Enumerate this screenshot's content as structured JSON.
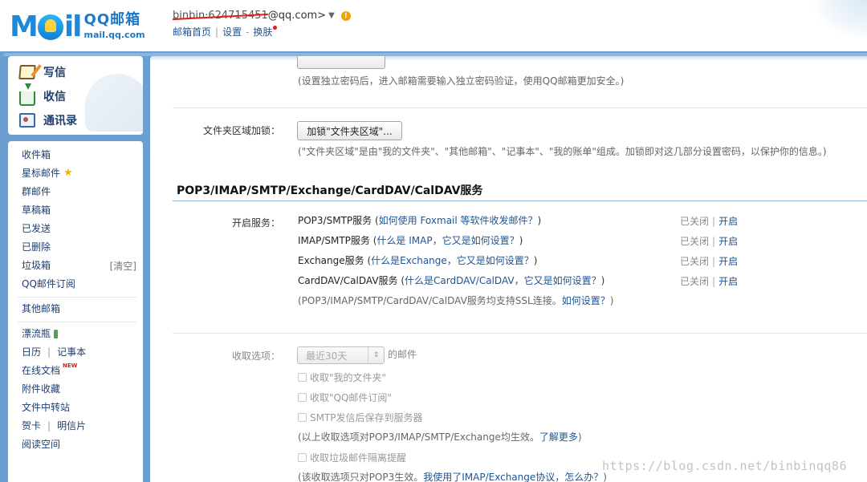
{
  "header": {
    "logo_word": [
      "M",
      "",
      "i",
      "l"
    ],
    "logo_cn": "QQ邮箱",
    "logo_url": "mail.qq.com",
    "account_masked": "binbin·624715451",
    "account_suffix": "@qq.com>",
    "account_arrow": "▼",
    "warn_icon": "!",
    "nav": {
      "home": "邮箱首页",
      "sep1": "|",
      "settings": "设置",
      "sep2": "-",
      "skin": "换肤"
    }
  },
  "sidebar": {
    "quick": [
      {
        "label": "写信",
        "icon": "compose-icon"
      },
      {
        "label": "收信",
        "icon": "receive-icon"
      },
      {
        "label": "通讯录",
        "icon": "contacts-icon"
      }
    ],
    "folders": {
      "inbox": "收件箱",
      "starred": "星标邮件",
      "group": "群邮件",
      "drafts": "草稿箱",
      "sent": "已发送",
      "deleted": "已删除",
      "junk": "垃圾箱",
      "junk_clear": "[清空]",
      "subscriptions": "QQ邮件订阅"
    },
    "other_mailboxes": "其他邮箱",
    "apps": {
      "drift_bottle": "漂流瓶",
      "calendar": "日历",
      "notes": "记事本",
      "online_docs": "在线文档",
      "new_badge": "NEW",
      "attachments": "附件收藏",
      "file_transfer": "文件中转站",
      "cards": "贺卡",
      "postcards": "明信片",
      "reading": "阅读空间",
      "sep": "|"
    }
  },
  "main": {
    "password_hint": "(设置独立密码后，进入邮箱需要输入独立密码验证，使用QQ邮箱更加安全。)",
    "folder_lock": {
      "label": "文件夹区域加锁：",
      "button": "加锁\"文件夹区域\"...",
      "hint": "(\"文件夹区域\"是由\"我的文件夹\"、\"其他邮箱\"、\"记事本\"、\"我的账单\"组成。加锁即对这几部分设置密码，以保护你的信息。)"
    },
    "section_title": "POP3/IMAP/SMTP/Exchange/CardDAV/CalDAV服务",
    "services_label": "开启服务：",
    "services": [
      {
        "name": "POP3/SMTP服务",
        "paren_open": " (",
        "help": "如何使用 Foxmail 等软件收发邮件？",
        "paren_close": ")",
        "status": "已关闭",
        "bar": "|",
        "action": "开启"
      },
      {
        "name": "IMAP/SMTP服务",
        "paren_open": " (",
        "help": "什么是 IMAP，它又是如何设置？",
        "paren_close": ")",
        "status": "已关闭",
        "bar": "|",
        "action": "开启"
      },
      {
        "name": "Exchange服务",
        "paren_open": " (",
        "help": "什么是Exchange，它又是如何设置？",
        "paren_close": ")",
        "status": "已关闭",
        "bar": "|",
        "action": "开启"
      },
      {
        "name": "CardDAV/CalDAV服务",
        "paren_open": " (",
        "help": "什么是CardDAV/CalDAV，它又是如何设置？",
        "paren_close": ")",
        "status": "已关闭",
        "bar": "|",
        "action": "开启"
      }
    ],
    "ssl_hint": "(POP3/IMAP/SMTP/CardDAV/CalDAV服务均支持SSL连接。",
    "ssl_link": "如何设置？",
    "ssl_close": ")",
    "receive": {
      "label": "收取选项：",
      "select_value": "最近30天",
      "select_arrows": "⇕",
      "suffix": "的邮件",
      "opt1": "收取\"我的文件夹\"",
      "opt2": "收取\"QQ邮件订阅\"",
      "opt3": "SMTP发信后保存到服务器",
      "note1": "(以上收取选项对POP3/IMAP/SMTP/Exchange均生效。",
      "note1_link": "了解更多",
      "note1_close": ")",
      "opt4": "收取垃圾邮件隔离提醒",
      "note2": "(该收取选项只对POP3生效。",
      "note2_link": "我使用了IMAP/Exchange协议，怎么办？",
      "note2_close": ")"
    }
  },
  "watermark": "https://blog.csdn.net/binbinqq86"
}
